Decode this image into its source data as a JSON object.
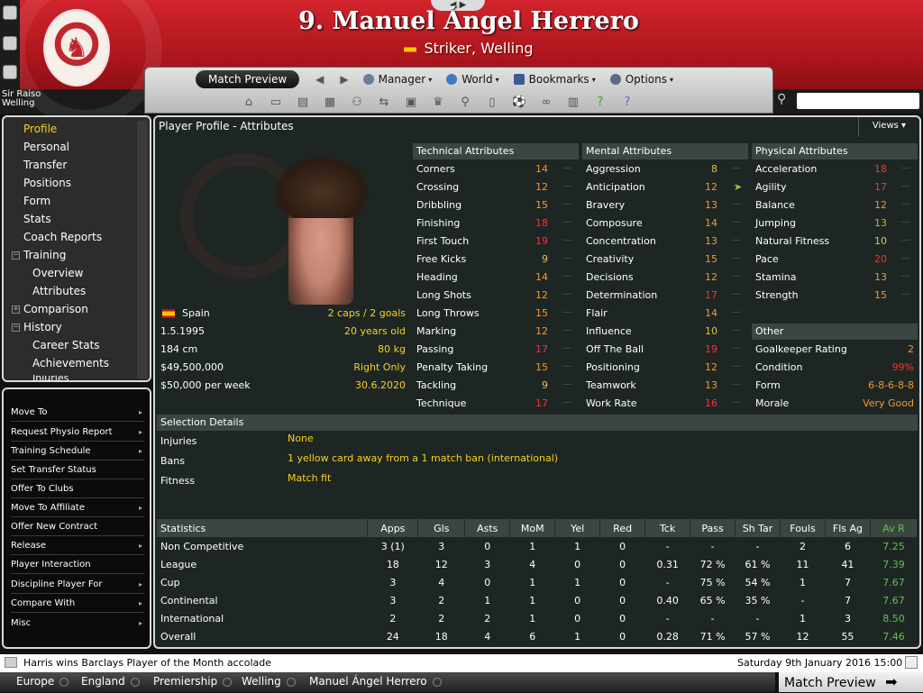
{
  "header": {
    "player_title": "9. Manuel Ángel Herrero",
    "player_subtitle": "Striker, Welling",
    "manager_name": "Sir Raiso",
    "manager_club": "Welling",
    "nav_arrows": "◀ ▶"
  },
  "nav": {
    "match_preview": "Match Preview",
    "manager": "Manager",
    "world": "World",
    "bookmarks": "Bookmarks",
    "options": "Options"
  },
  "sidebar": {
    "items": [
      {
        "label": "Profile"
      },
      {
        "label": "Personal"
      },
      {
        "label": "Transfer"
      },
      {
        "label": "Positions"
      },
      {
        "label": "Form"
      },
      {
        "label": "Stats"
      },
      {
        "label": "Coach Reports"
      },
      {
        "label": "Training"
      },
      {
        "label": "Overview"
      },
      {
        "label": "Attributes"
      },
      {
        "label": "Comparison"
      },
      {
        "label": "History"
      },
      {
        "label": "Career Stats"
      },
      {
        "label": "Achievements"
      },
      {
        "label": "Injuries"
      }
    ],
    "tree_expand": "+",
    "tree_collapse": "−"
  },
  "actions": [
    {
      "label": "Move To",
      "arrow": "▸"
    },
    {
      "label": "Request Physio Report",
      "arrow": "▸"
    },
    {
      "label": "Training Schedule",
      "arrow": "▸"
    },
    {
      "label": "Set Transfer Status",
      "arrow": ""
    },
    {
      "label": "Offer To Clubs",
      "arrow": ""
    },
    {
      "label": "Move To Affiliate",
      "arrow": "▸"
    },
    {
      "label": "Offer New Contract",
      "arrow": ""
    },
    {
      "label": "Release",
      "arrow": "▸"
    },
    {
      "label": "Player Interaction",
      "arrow": ""
    },
    {
      "label": "Discipline Player For",
      "arrow": "▸"
    },
    {
      "label": "Compare With",
      "arrow": "▸"
    },
    {
      "label": "Misc",
      "arrow": "▸"
    }
  ],
  "main": {
    "title": "Player Profile - Attributes",
    "views_label": "Views",
    "caret": "▾"
  },
  "profile": {
    "nationality": "Spain",
    "caps": "2 caps / 2 goals",
    "dob": "1.5.1995",
    "age": "20 years old",
    "height": "184 cm",
    "weight": "80 kg",
    "value": "$49,500,000",
    "foot": "Right Only",
    "wage": "$50,000 per week",
    "contract_end": "30.6.2020"
  },
  "technical": {
    "header": "Technical Attributes",
    "items": [
      {
        "name": "Corners",
        "value": "14",
        "color": "org"
      },
      {
        "name": "Crossing",
        "value": "12",
        "color": "org"
      },
      {
        "name": "Dribbling",
        "value": "15",
        "color": "org"
      },
      {
        "name": "Finishing",
        "value": "18",
        "color": "red"
      },
      {
        "name": "First Touch",
        "value": "19",
        "color": "red"
      },
      {
        "name": "Free Kicks",
        "value": "9",
        "color": "yel"
      },
      {
        "name": "Heading",
        "value": "14",
        "color": "org"
      },
      {
        "name": "Long Shots",
        "value": "12",
        "color": "org"
      },
      {
        "name": "Long Throws",
        "value": "15",
        "color": "org"
      },
      {
        "name": "Marking",
        "value": "12",
        "color": "org"
      },
      {
        "name": "Passing",
        "value": "17",
        "color": "red"
      },
      {
        "name": "Penalty Taking",
        "value": "15",
        "color": "org"
      },
      {
        "name": "Tackling",
        "value": "9",
        "color": "yel"
      },
      {
        "name": "Technique",
        "value": "17",
        "color": "red"
      }
    ]
  },
  "mental": {
    "header": "Mental Attributes",
    "items": [
      {
        "name": "Aggression",
        "value": "8",
        "color": "yel"
      },
      {
        "name": "Anticipation",
        "value": "12",
        "color": "org"
      },
      {
        "name": "Bravery",
        "value": "13",
        "color": "org"
      },
      {
        "name": "Composure",
        "value": "14",
        "color": "org"
      },
      {
        "name": "Concentration",
        "value": "13",
        "color": "org"
      },
      {
        "name": "Creativity",
        "value": "15",
        "color": "org"
      },
      {
        "name": "Decisions",
        "value": "12",
        "color": "org"
      },
      {
        "name": "Determination",
        "value": "17",
        "color": "red"
      },
      {
        "name": "Flair",
        "value": "14",
        "color": "org"
      },
      {
        "name": "Influence",
        "value": "10",
        "color": "yel"
      },
      {
        "name": "Off The Ball",
        "value": "19",
        "color": "red"
      },
      {
        "name": "Positioning",
        "value": "12",
        "color": "org"
      },
      {
        "name": "Teamwork",
        "value": "13",
        "color": "org"
      },
      {
        "name": "Work Rate",
        "value": "16",
        "color": "red"
      }
    ]
  },
  "physical": {
    "header": "Physical Attributes",
    "items": [
      {
        "name": "Acceleration",
        "value": "18",
        "color": "red"
      },
      {
        "name": "Agility",
        "value": "17",
        "color": "red"
      },
      {
        "name": "Balance",
        "value": "12",
        "color": "org"
      },
      {
        "name": "Jumping",
        "value": "13",
        "color": "org"
      },
      {
        "name": "Natural Fitness",
        "value": "10",
        "color": "yel"
      },
      {
        "name": "Pace",
        "value": "20",
        "color": "red"
      },
      {
        "name": "Stamina",
        "value": "13",
        "color": "org"
      },
      {
        "name": "Strength",
        "value": "15",
        "color": "org"
      }
    ]
  },
  "other": {
    "header": "Other",
    "items": [
      {
        "name": "Goalkeeper Rating",
        "value": "2",
        "color": "org"
      },
      {
        "name": "Condition",
        "value": "99%",
        "color": "red"
      },
      {
        "name": "Form",
        "value": "6-8-6-8-8",
        "color": "org"
      },
      {
        "name": "Morale",
        "value": "Very Good",
        "color": "org"
      }
    ]
  },
  "selection": {
    "header": "Selection Details",
    "injuries_label": "Injuries",
    "injuries_value": "None",
    "bans_label": "Bans",
    "bans_value": "1 yellow card away from a 1 match ban (international)",
    "fitness_label": "Fitness",
    "fitness_value": "Match fit"
  },
  "stats": {
    "headers": [
      "Statistics",
      "Apps",
      "Gls",
      "Asts",
      "MoM",
      "Yel",
      "Red",
      "Tck",
      "Pass",
      "Sh Tar",
      "Fouls",
      "Fls Ag",
      "Av R"
    ],
    "rows": [
      [
        "Non Competitive",
        "3 (1)",
        "3",
        "0",
        "1",
        "1",
        "0",
        "-",
        "-",
        "-",
        "2",
        "6",
        "7.25"
      ],
      [
        "League",
        "18",
        "12",
        "3",
        "4",
        "0",
        "0",
        "0.31",
        "72 %",
        "61 %",
        "11",
        "41",
        "7.39"
      ],
      [
        "Cup",
        "3",
        "4",
        "0",
        "1",
        "1",
        "0",
        "-",
        "75 %",
        "54 %",
        "1",
        "7",
        "7.67"
      ],
      [
        "Continental",
        "3",
        "2",
        "1",
        "1",
        "0",
        "0",
        "0.40",
        "65 %",
        "35 %",
        "-",
        "7",
        "7.67"
      ],
      [
        "International",
        "2",
        "2",
        "2",
        "1",
        "0",
        "0",
        "-",
        "-",
        "-",
        "1",
        "3",
        "8.50"
      ],
      [
        "Overall",
        "24",
        "18",
        "4",
        "6",
        "1",
        "0",
        "0.28",
        "71 %",
        "57 %",
        "12",
        "55",
        "7.46"
      ]
    ]
  },
  "bottom": {
    "news": "Harris wins Barclays Player of the Month accolade",
    "datetime": "Saturday 9th January 2016 15:00",
    "crumbs": [
      "Europe",
      "England",
      "Premiership",
      "Welling",
      "Manuel Ángel Herrero"
    ],
    "match_preview_btn": "Match Preview"
  }
}
